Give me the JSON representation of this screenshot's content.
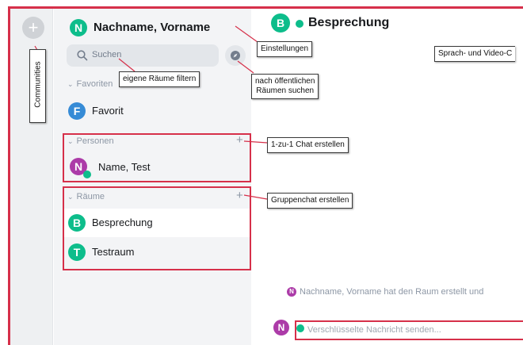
{
  "user": {
    "avatar_letter": "N",
    "display_name": "Nachname, Vorname"
  },
  "search": {
    "placeholder": "Suchen"
  },
  "sections": {
    "favorites": {
      "label": "Favoriten",
      "items": [
        {
          "avatar_letter": "F",
          "name": "Favorit"
        }
      ]
    },
    "people": {
      "label": "Personen",
      "items": [
        {
          "avatar_letter": "N",
          "name": "Name, Test"
        }
      ]
    },
    "rooms": {
      "label": "Räume",
      "items": [
        {
          "avatar_letter": "B",
          "name": "Besprechung",
          "selected": true
        },
        {
          "avatar_letter": "T",
          "name": "Testraum"
        }
      ]
    }
  },
  "room_header": {
    "avatar_letter": "B",
    "title": "Besprechung"
  },
  "timeline": {
    "avatar_letter": "N",
    "event_text": "Nachname, Vorname hat den Raum erstellt und"
  },
  "composer": {
    "avatar_letter": "N",
    "placeholder": "Verschlüsselte Nachricht senden..."
  },
  "annotations": {
    "communities": "Communities",
    "settings": "Einstellungen",
    "filter_rooms": "eigene Räume filtern",
    "search_public_rooms": "nach öffentlichen Räumen suchen",
    "search_public_rooms_line1": "nach öffentlichen",
    "search_public_rooms_line2": "Räumen suchen",
    "create_dm": "1-zu-1 Chat erstellen",
    "create_group": "Gruppenchat erstellen",
    "voice_video": "Sprach- und Video-C"
  },
  "colors": {
    "accent_green": "#0dbd8b",
    "highlight_red": "#d6304a",
    "avatar_blue": "#368bd6",
    "avatar_purple": "#ac3ba8"
  }
}
